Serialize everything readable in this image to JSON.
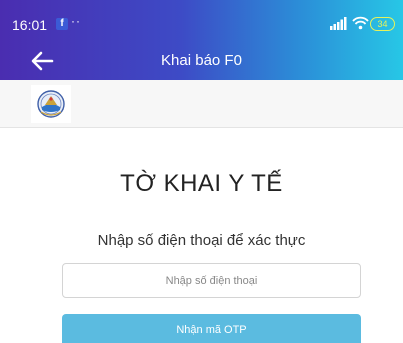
{
  "status_bar": {
    "time": "16:01",
    "notification_dots": "··",
    "battery": "34"
  },
  "app_bar": {
    "title": "Khai báo F0"
  },
  "form": {
    "heading": "TỜ KHAI Y TẾ",
    "subheading": "Nhập số điện thoại để xác thực",
    "phone_placeholder": "Nhập số điện thoại",
    "phone_value": "",
    "submit_label": "Nhận mã OTP"
  },
  "colors": {
    "header_gradient_start": "#4a2db0",
    "header_gradient_end": "#27c7e6",
    "button": "#5bbbe0"
  },
  "icons": {
    "back": "arrow-left-icon",
    "facebook": "facebook-icon",
    "signal": "signal-icon",
    "wifi": "wifi-icon",
    "battery": "battery-icon",
    "logo": "emblem-logo"
  }
}
